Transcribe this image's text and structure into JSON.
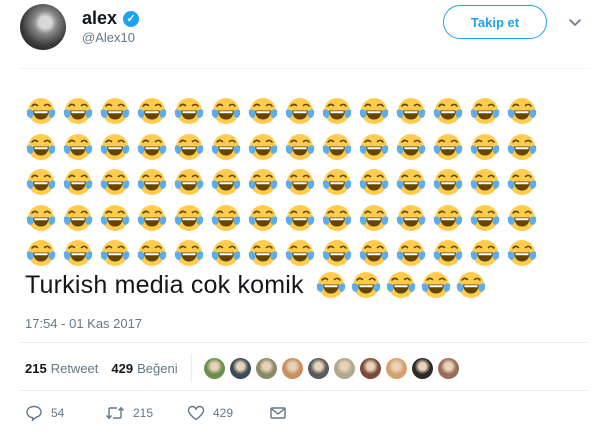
{
  "user": {
    "name": "alex",
    "handle": "@Alex10"
  },
  "follow_label": "Takip et",
  "tweet": {
    "text": "Turkish media cok komik",
    "emoji_grid_count": 70,
    "inline_emoji_count": 5,
    "emoji_name": "face-with-tears-of-joy"
  },
  "timestamp": "17:54 - 01 Kas 2017",
  "stats": {
    "retweets": "215",
    "retweets_label": "Retweet",
    "likes": "429",
    "likes_label": "Beğeni"
  },
  "likers": [
    "#6a8f4e",
    "#3d4a57",
    "#8a8a6a",
    "#c98f5e",
    "#5a5a5a",
    "#b0a890",
    "#7a4a3a",
    "#d4a070",
    "#2a2a2a",
    "#9a6a5a"
  ],
  "actions": {
    "replies": "54",
    "retweets": "215",
    "likes": "429"
  },
  "colors": {
    "accent": "#1da1f2",
    "muted": "#657786",
    "text": "#14171a"
  }
}
